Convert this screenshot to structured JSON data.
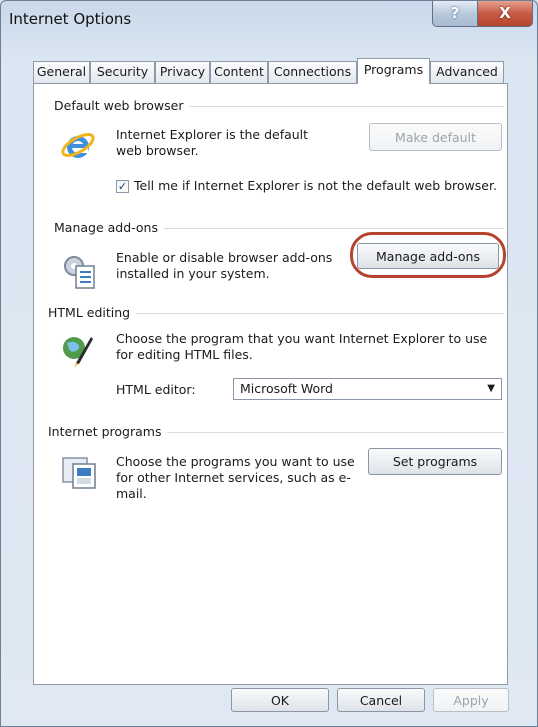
{
  "window": {
    "title": "Internet Options",
    "help_glyph": "?",
    "close_glyph": "X"
  },
  "tabs": [
    {
      "label": "General"
    },
    {
      "label": "Security"
    },
    {
      "label": "Privacy"
    },
    {
      "label": "Content"
    },
    {
      "label": "Connections"
    },
    {
      "label": "Programs"
    },
    {
      "label": "Advanced"
    }
  ],
  "active_tab": "Programs",
  "default_browser": {
    "group_title": "Default web browser",
    "description": "Internet Explorer is the default web browser.",
    "make_default_label": "Make default",
    "checkbox_checked": true,
    "checkbox_label": "Tell me if Internet Explorer is not the default web browser."
  },
  "manage_addons": {
    "group_title": "Manage add-ons",
    "description": "Enable or disable browser add-ons installed in your system.",
    "button_label": "Manage add-ons"
  },
  "html_editing": {
    "group_title": "HTML editing",
    "description": "Choose the program that you want Internet Explorer to use for editing HTML files.",
    "editor_label": "HTML editor:",
    "editor_value": "Microsoft Word",
    "caret": "▼"
  },
  "internet_programs": {
    "group_title": "Internet programs",
    "description": "Choose the programs you want to use for other Internet services, such as e-mail.",
    "button_label": "Set programs"
  },
  "footer": {
    "ok_label": "OK",
    "cancel_label": "Cancel",
    "apply_label": "Apply"
  },
  "colors": {
    "highlight": "#b5432e",
    "ie_blue": "#2a7fd4",
    "ie_ring": "#f2b41c"
  },
  "icons": {
    "ie": "internet-explorer-icon",
    "addons": "add-ons-gears-icon",
    "html": "html-editor-icon",
    "programs": "programs-icon"
  }
}
